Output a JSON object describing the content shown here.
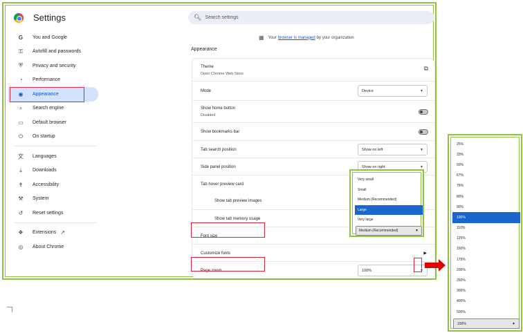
{
  "app": {
    "title": "Settings"
  },
  "search": {
    "placeholder": "Search settings"
  },
  "sidebar": {
    "items": [
      {
        "label": "You and Google",
        "icon": "google-g-icon"
      },
      {
        "label": "Autofill and passwords",
        "icon": "key-icon"
      },
      {
        "label": "Privacy and security",
        "icon": "shield-icon"
      },
      {
        "label": "Performance",
        "icon": "gauge-icon"
      },
      {
        "label": "Appearance",
        "icon": "palette-icon",
        "active": true
      },
      {
        "label": "Search engine",
        "icon": "search-icon"
      },
      {
        "label": "Default browser",
        "icon": "browser-icon"
      },
      {
        "label": "On startup",
        "icon": "power-icon"
      },
      {
        "label": "Languages",
        "icon": "translate-icon"
      },
      {
        "label": "Downloads",
        "icon": "download-icon"
      },
      {
        "label": "Accessibility",
        "icon": "accessibility-icon"
      },
      {
        "label": "System",
        "icon": "wrench-icon"
      },
      {
        "label": "Reset settings",
        "icon": "reset-icon"
      },
      {
        "label": "Extensions",
        "icon": "puzzle-icon"
      },
      {
        "label": "About Chrome",
        "icon": "chrome-icon"
      }
    ]
  },
  "managed_notice": {
    "prefix": "Your",
    "link": "browser is managed",
    "suffix": "by your organization"
  },
  "section": {
    "title": "Appearance"
  },
  "appearance": {
    "theme": {
      "label": "Theme",
      "sub": "Open Chrome Web Store"
    },
    "mode": {
      "label": "Mode",
      "value": "Device"
    },
    "home_button": {
      "label": "Show home button",
      "sub": "Disabled"
    },
    "bookmarks_bar": {
      "label": "Show bookmarks bar"
    },
    "tab_search": {
      "label": "Tab search position",
      "value": "Show on left"
    },
    "side_panel": {
      "label": "Side panel position",
      "value": "Show on right"
    },
    "hover_card": {
      "label": "Tab hover preview card"
    },
    "tab_images": {
      "label": "Show tab preview images"
    },
    "tab_memory": {
      "label": "Show tab memory usage"
    },
    "font_size": {
      "label": "Font size",
      "value": "Medium (Recommended)"
    },
    "custom_fonts": {
      "label": "Customize fonts"
    },
    "page_zoom": {
      "label": "Page zoom",
      "value": "100%"
    }
  },
  "font_size_dropdown": {
    "options": [
      "Very small",
      "Small",
      "Medium (Recommended)",
      "Large",
      "Very large"
    ],
    "highlighted": "Large",
    "selected_value": "Medium (Recommended)"
  },
  "zoom_dropdown": {
    "options": [
      "25%",
      "33%",
      "50%",
      "67%",
      "75%",
      "80%",
      "90%",
      "100%",
      "110%",
      "125%",
      "150%",
      "175%",
      "200%",
      "250%",
      "300%",
      "400%",
      "500%"
    ],
    "highlighted": "100%",
    "selected_value": "100%"
  },
  "colors": {
    "accent": "#0b57d0",
    "highlight_box": "#e0243a",
    "frame_green": "#8cc63f",
    "arrow": "#e00000",
    "option_selected": "#1a66cc"
  }
}
